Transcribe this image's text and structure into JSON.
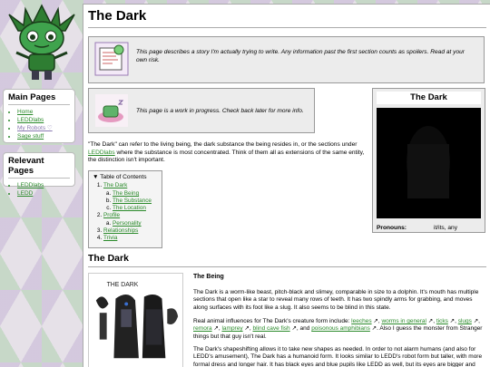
{
  "logo": {
    "icon": "green-robot-mascot"
  },
  "sidebar": {
    "main_pages": {
      "title": "Main Pages",
      "items": [
        "Home",
        "LEDDlabs",
        "My Robots ♡",
        "Sage stuff"
      ]
    },
    "relevant_pages": {
      "title": "Relevant Pages",
      "items": [
        "LEDDlabs",
        "LEDD"
      ]
    }
  },
  "page": {
    "title": "The Dark",
    "notice_story": "This page describes a story I'm actually trying to write. Any information past the first section counts as spoilers. Read at your own risk.",
    "notice_wip": "This page is a work in progress. Check back later for more info.",
    "intro_a": "\"The Dark\" can refer to the living being, the dark substance the being resides in, or the sections under ",
    "intro_link": "LEDDlabs",
    "intro_b": " where the substance is most concentrated. Think of them all as extensions of the same entity, the distinction isn't important."
  },
  "toc": {
    "header": "▼ Table of Contents",
    "items": [
      {
        "label": "The Dark",
        "children": [
          "The Being",
          "The Substance",
          "The Location"
        ]
      },
      {
        "label": "Profile",
        "children": [
          "Personality"
        ]
      },
      {
        "label": "Relationships",
        "children": []
      },
      {
        "label": "Trivia",
        "children": []
      }
    ]
  },
  "infobox": {
    "title": "The Dark",
    "pronouns_label": "Pronouns:",
    "pronouns_value": "it/its, any"
  },
  "section": {
    "title": "The Dark",
    "art_label": "THE DARK",
    "subsection_title": "The Being",
    "p1": "The Dark is a worm-like beast, pitch-black and slimey, comparable in size to a dolphin. It's mouth has multiple sections that open like a star to reveal many rows of teeth. It has two spindly arms for grabbing, and moves along surfaces with its foot like a slug. It also seems to be blind in this state.",
    "p2_a": "Real animal influences for The Dark's creature form include: ",
    "p2_links": [
      "leeches",
      "worms in general",
      "ticks",
      "slugs",
      "remora",
      "lamprey",
      "blind cave fish",
      "poisonous amphibians"
    ],
    "p2_b": ". Also I guess the monster from Stranger things but that guy isn't real.",
    "p3": "The Dark's shapeshifting allows it to take new shapes as needed. In order to not alarm humans (and also for LEDD's amusement), The Dark has a humanoid form. It looks similar to LEDD's robot form but taller, with more formal dress and longer hair. It has black eyes and blue pupils like LEDD as well, but its eyes are bigger and more realistic. Whether The Dark can actually see with these eyes is unclear. It does not have"
  },
  "colors": {
    "link": "#2a8a2a",
    "notice_bg": "#ececec",
    "image_bg": "#000000"
  }
}
